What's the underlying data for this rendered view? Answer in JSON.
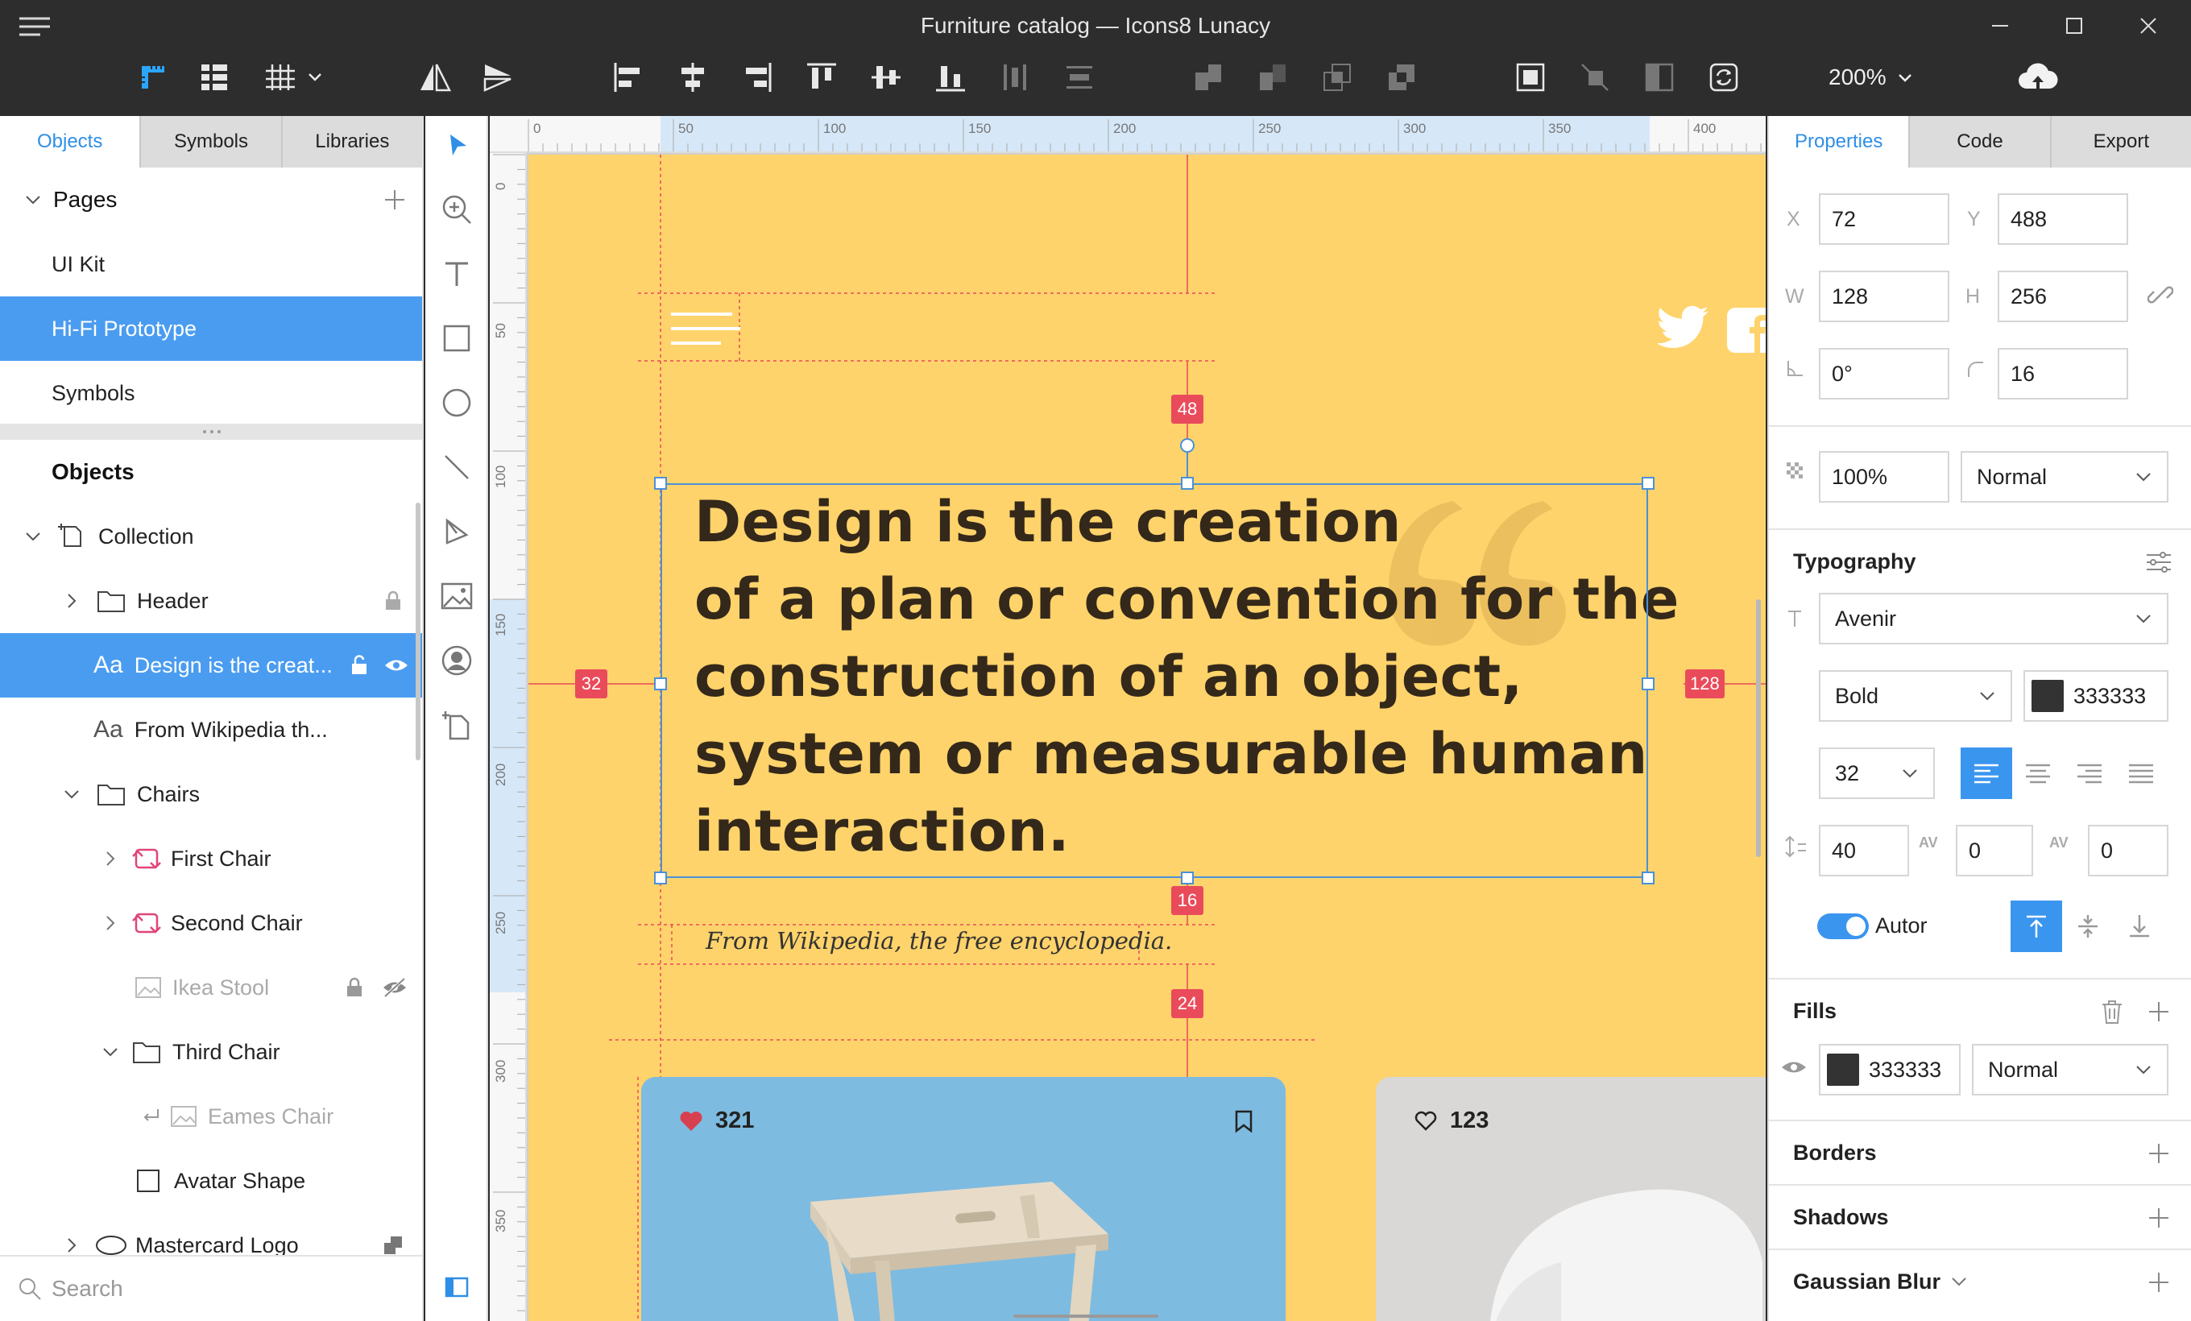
{
  "window": {
    "title": "Furniture catalog — Icons8 Lunacy",
    "zoom": "200%"
  },
  "left_panel": {
    "tabs": [
      "Objects",
      "Symbols",
      "Libraries"
    ],
    "pages_header": "Pages",
    "pages": [
      "UI Kit",
      "Hi-Fi Prototype",
      "Symbols"
    ],
    "objects_header": "Objects",
    "layers": [
      "Collection",
      "Header",
      "Design is the creat...",
      "From Wikipedia th...",
      "Chairs",
      "First Chair",
      "Second Chair",
      "Ikea Stool",
      "Third Chair",
      "Eames Chair",
      "Avatar Shape",
      "Mastercard Logo"
    ],
    "search_placeholder": "Search"
  },
  "canvas": {
    "ruler_top": [
      "0",
      "50",
      "100",
      "150",
      "200",
      "250",
      "300",
      "350",
      "400"
    ],
    "ruler_left": [
      "0",
      "50",
      "100",
      "150",
      "200",
      "250",
      "300",
      "350"
    ],
    "quote_lines": [
      "Design is the creation",
      "of a plan or convention for the",
      "construction of an object,",
      "system or measurable human",
      "interaction."
    ],
    "wiki": "From Wikipedia, the free encyclopedia.",
    "measures": {
      "top": "48",
      "left": "32",
      "right": "128",
      "bottom": "16",
      "below": "24"
    },
    "cards": [
      {
        "likes": "321"
      },
      {
        "likes": "123"
      }
    ]
  },
  "right_panel": {
    "tabs": [
      "Properties",
      "Code",
      "Export"
    ],
    "geometry": {
      "x_label": "X",
      "x": "72",
      "y_label": "Y",
      "y": "488",
      "w_label": "W",
      "w": "128",
      "h_label": "H",
      "h": "256",
      "rotation": "0°",
      "radius": "16"
    },
    "opacity": "100%",
    "blend": "Normal",
    "typography": {
      "header": "Typography",
      "font": "Avenir",
      "weight": "Bold",
      "color": "333333",
      "size": "32",
      "line_height": "40",
      "char_spacing": "0",
      "para_spacing": "0",
      "autor_label": "Autor"
    },
    "fills": {
      "header": "Fills",
      "color": "333333",
      "blend": "Normal"
    },
    "sections": [
      "Borders",
      "Shadows",
      "Gaussian Blur"
    ]
  },
  "colors": {
    "accent": "#3a95ef",
    "artboard": "#ffd36b",
    "measure": "#e94b5b",
    "text_dark": "#333333"
  }
}
